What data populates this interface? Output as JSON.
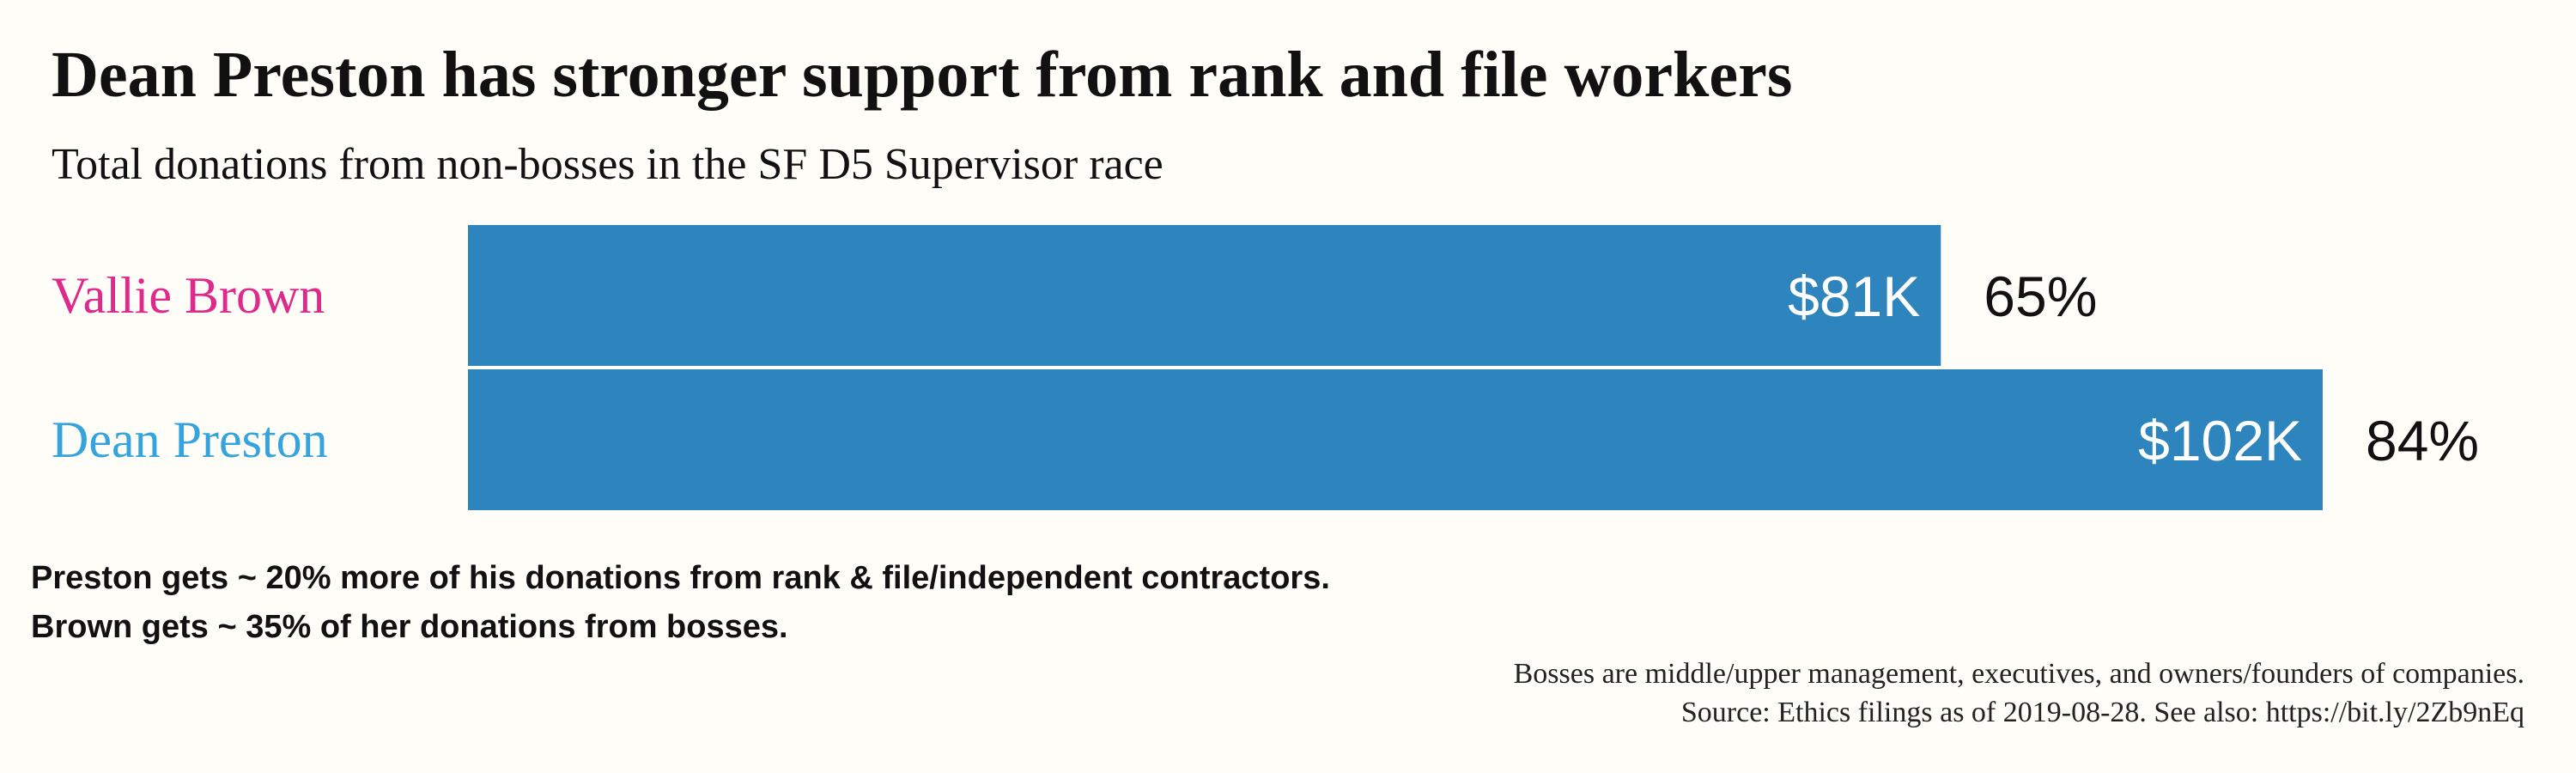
{
  "chart_data": {
    "type": "bar",
    "orientation": "horizontal",
    "title": "Dean Preston has stronger support from rank and file workers",
    "subtitle": "Total donations from non-bosses in the SF D5 Supervisor race",
    "categories": [
      "Vallie Brown",
      "Dean Preston"
    ],
    "values": [
      81,
      102
    ],
    "value_labels": [
      "$81K",
      "$102K"
    ],
    "percent_labels": [
      "65%",
      "84%"
    ],
    "category_colors": [
      "#dd2a8b",
      "#35a3dd"
    ],
    "bar_color": "#2e84bd",
    "xlim": [
      0,
      102
    ],
    "grid": false,
    "notes": [
      "Preston gets ~ 20% more of his donations from rank & file/independent contractors.",
      "Brown gets ~ 35% of her donations from bosses."
    ],
    "footer": [
      "Bosses are middle/upper management, executives, and owners/founders of companies.",
      "Source: Ethics filings as of 2019-08-28. See also: https://bit.ly/2Zb9nEq"
    ]
  }
}
